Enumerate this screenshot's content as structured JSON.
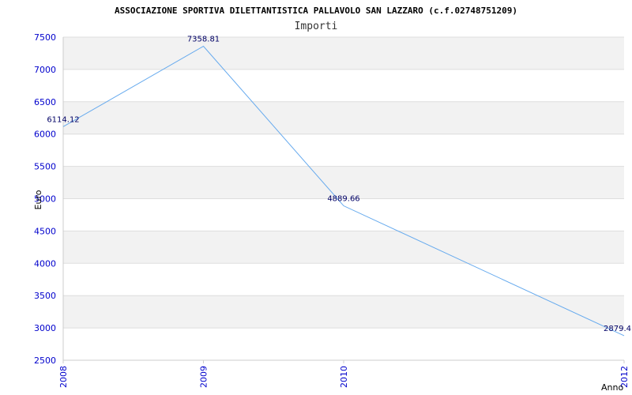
{
  "chart_data": {
    "type": "line",
    "title": "ASSOCIAZIONE SPORTIVA DILETTANTISTICA PALLAVOLO SAN LAZZARO (c.f.02748751209)",
    "subtitle": "Importi",
    "xlabel": "Anno",
    "ylabel": "Euro",
    "x": [
      "2008",
      "2009",
      "2010",
      "2012"
    ],
    "series": [
      {
        "values": [
          6114.12,
          7358.81,
          4889.66,
          2879.4
        ]
      }
    ],
    "data_labels": [
      "6114.12",
      "7358.81",
      "4889.66",
      "2879.4"
    ],
    "ylim": [
      2500,
      7500
    ],
    "yticks": [
      "2500",
      "3000",
      "3500",
      "4000",
      "4500",
      "5000",
      "5500",
      "6000",
      "6500",
      "7000",
      "7500"
    ],
    "grid": true,
    "line_color": "#66aaee",
    "tick_color": "#0000cc",
    "band_color": "#f2f2f2"
  }
}
